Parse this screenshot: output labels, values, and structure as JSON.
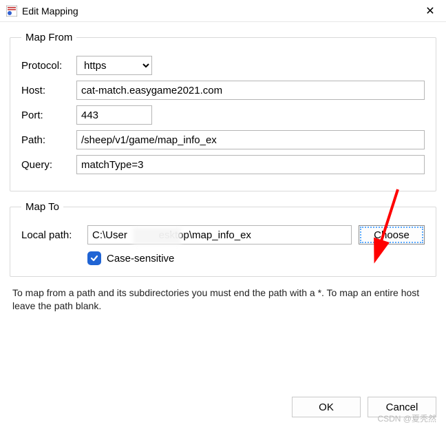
{
  "window": {
    "title": "Edit Mapping"
  },
  "group_from": {
    "legend": "Map From",
    "protocol_label": "Protocol:",
    "protocol_value": "https",
    "host_label": "Host:",
    "host_value": "cat-match.easygame2021.com",
    "port_label": "Port:",
    "port_value": "443",
    "path_label": "Path:",
    "path_value": "/sheep/v1/game/map_info_ex",
    "query_label": "Query:",
    "query_value": "matchType=3"
  },
  "group_to": {
    "legend": "Map To",
    "local_path_label": "Local path:",
    "local_path_value": "C:\\User           esktop\\map_info_ex",
    "choose_label": "Choose",
    "case_sensitive_label": "Case-sensitive",
    "case_sensitive_checked": true
  },
  "note": "To map from a path and its subdirectories you must end the path with a *. To map an entire host leave the path blank.",
  "buttons": {
    "ok": "OK",
    "cancel": "Cancel"
  },
  "watermark": "CSDN @夏秃然"
}
